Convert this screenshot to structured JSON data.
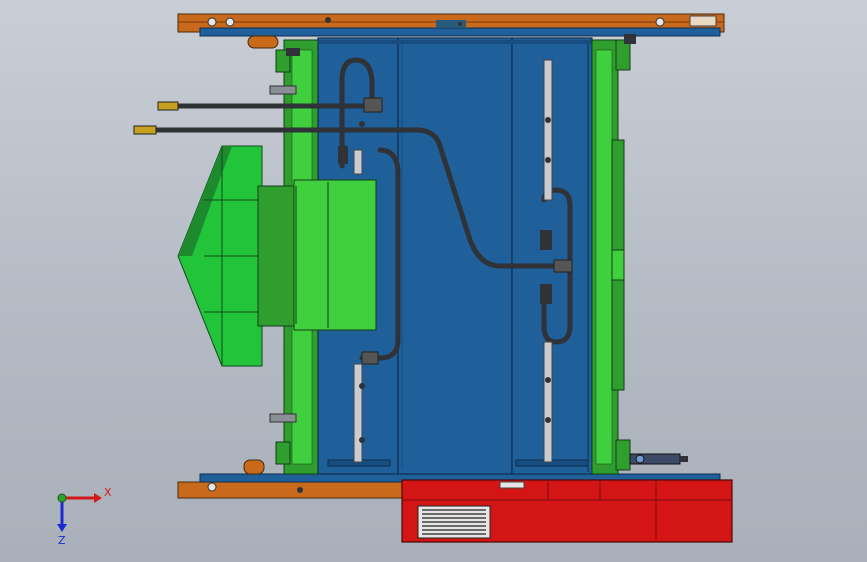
{
  "viewport": {
    "background_top": "#c9ced6",
    "background_bottom": "#aab0b9"
  },
  "triad": {
    "x_label": "X",
    "z_label": "Z",
    "x_color": "#d21a1a",
    "y_color": "#2aa52a",
    "z_color": "#1a2ad2"
  },
  "colors": {
    "mold_plate_blue": "#1f5f9a",
    "mold_plate_blue_dark": "#174d80",
    "clamp_plate_orange": "#c8691c",
    "guide_green": "#2f9e2f",
    "guide_green_light": "#3fcf3f",
    "hot_runner_box_red": "#d41515",
    "hose_dark": "#2f3236",
    "pipe_light": "#c9cdd2"
  }
}
